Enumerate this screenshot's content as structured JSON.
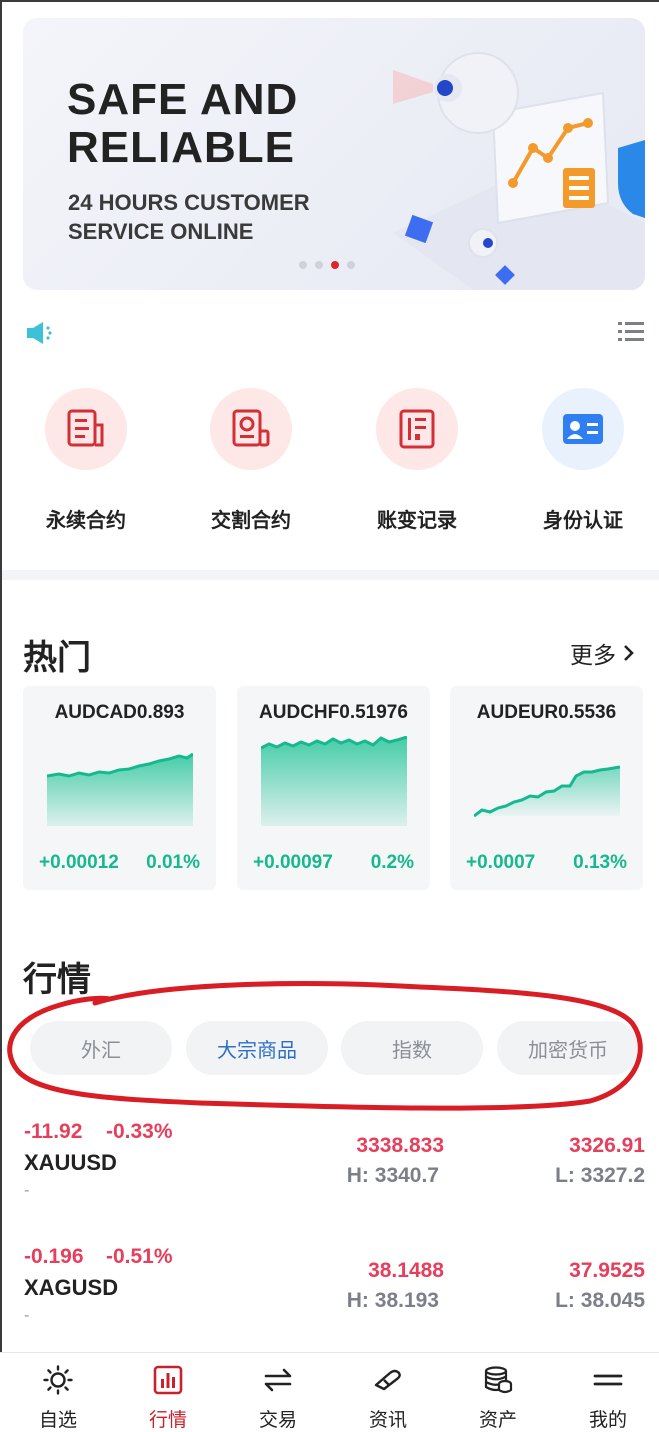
{
  "banner": {
    "title_line1": "SAFE AND",
    "title_line2": "RELIABLE",
    "subtitle_line1": "24 HOURS CUSTOMER",
    "subtitle_line2": "SERVICE ONLINE",
    "slide_count": 4,
    "active_slide": 3
  },
  "quick_entries": [
    {
      "label": "永续合约",
      "icon": "document-icon"
    },
    {
      "label": "交割合约",
      "icon": "contract-icon"
    },
    {
      "label": "账变记录",
      "icon": "record-icon"
    },
    {
      "label": "身份认证",
      "icon": "id-card-icon"
    }
  ],
  "hot": {
    "title": "热门",
    "more_label": "更多",
    "cards": [
      {
        "name": "AUDCAD0.893",
        "change": "+0.00012",
        "percent": "0.01%"
      },
      {
        "name": "AUDCHF0.51976",
        "change": "+0.00097",
        "percent": "0.2%"
      },
      {
        "name": "AUDEUR0.5536",
        "change": "+0.0007",
        "percent": "0.13%"
      }
    ]
  },
  "market": {
    "title": "行情",
    "tabs": [
      "外汇",
      "大宗商品",
      "指数",
      "加密货币"
    ],
    "active_tab": 1,
    "rows": [
      {
        "change": "-11.92",
        "percent": "-0.33%",
        "symbol": "XAUUSD",
        "sub": "-",
        "price": "3338.833",
        "price2": "3326.91",
        "high": "H: 3340.7",
        "low": "L: 3327.2"
      },
      {
        "change": "-0.196",
        "percent": "-0.51%",
        "symbol": "XAGUSD",
        "sub": "-",
        "price": "38.1488",
        "price2": "37.9525",
        "high": "H: 38.193",
        "low": "L: 38.045"
      }
    ]
  },
  "nav": {
    "items": [
      {
        "label": "自选",
        "icon": "sun-icon"
      },
      {
        "label": "行情",
        "icon": "chart-icon"
      },
      {
        "label": "交易",
        "icon": "swap-icon"
      },
      {
        "label": "资讯",
        "icon": "news-icon"
      },
      {
        "label": "资产",
        "icon": "coins-icon"
      },
      {
        "label": "我的",
        "icon": "profile-icon"
      }
    ],
    "active": 1
  },
  "colors": {
    "accent_red": "#c8222c",
    "up_green": "#16b98e",
    "down_red": "#e63f5c",
    "active_tab_blue": "#2b6fc7"
  }
}
